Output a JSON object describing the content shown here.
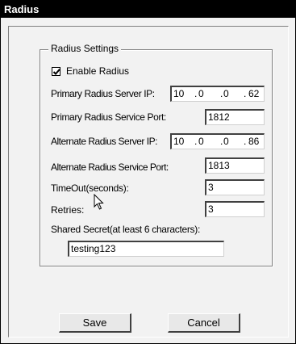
{
  "window": {
    "title": "Radius"
  },
  "group": {
    "legend": "Radius Settings"
  },
  "enable_radius": {
    "label": "Enable Radius",
    "checked": true
  },
  "primary_server_ip": {
    "label": "Primary Radius Server IP:",
    "octets": [
      "10",
      "0",
      "0",
      "62"
    ]
  },
  "primary_service_port": {
    "label": "Primary Radius Service Port:",
    "value": "1812"
  },
  "alternate_server_ip": {
    "label": "Alternate Radius Server IP:",
    "octets": [
      "10",
      "0",
      "0",
      "86"
    ]
  },
  "alternate_service_port": {
    "label": "Alternate Radius Service Port:",
    "value": "1813"
  },
  "timeout": {
    "label": "TimeOut(seconds):",
    "value": "3"
  },
  "retries": {
    "label": "Retries:",
    "value": "3"
  },
  "shared_secret": {
    "label": "Shared Secret(at least 6 characters):",
    "value": "testing123"
  },
  "buttons": {
    "save": "Save",
    "cancel": "Cancel"
  },
  "icons": {
    "checkmark": "checkmark-icon",
    "cursor": "mouse-pointer-icon"
  }
}
